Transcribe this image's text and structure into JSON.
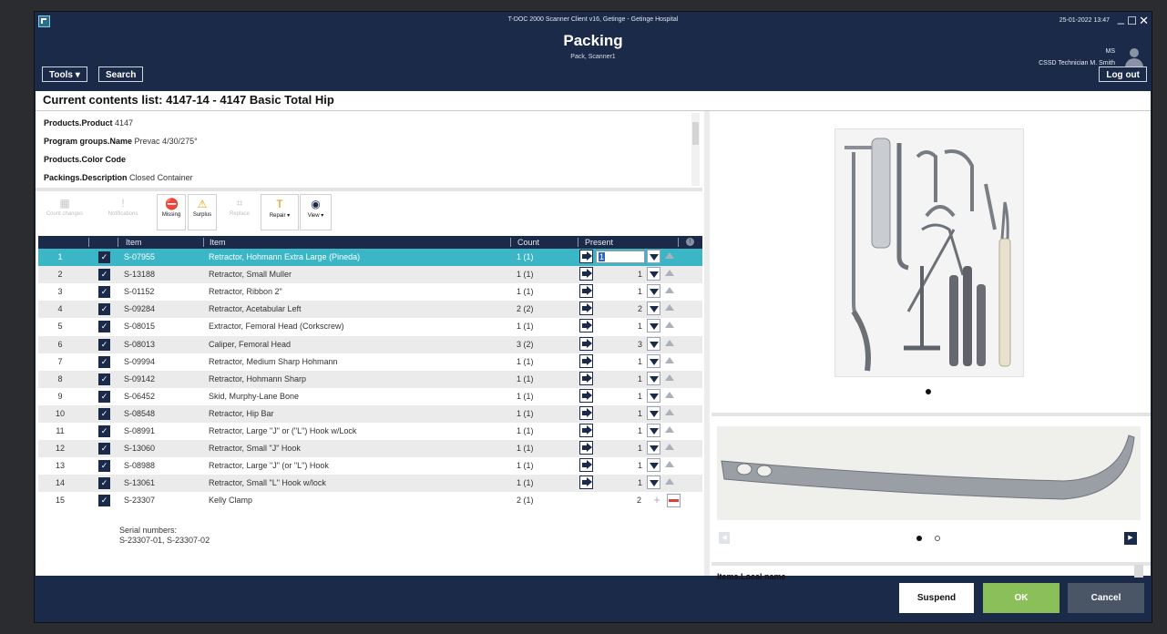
{
  "window": {
    "title": "T-DOC 2000 Scanner Client v16, Getinge - Getinge Hospital",
    "datetime": "25-01-2022 13:47",
    "min_glyph": "_",
    "max_glyph": "☐",
    "close_glyph": "✕"
  },
  "header": {
    "title": "Packing",
    "subtitle": "Pack, Scanner1",
    "tools_label": "Tools ▾",
    "search_label": "Search",
    "logout_label": "Log out",
    "user_initials": "MS",
    "user_role": "CSSD Technician M. Smith"
  },
  "list_title": "Current contents list: 4147-14 - 4147 Basic Total Hip",
  "properties": [
    {
      "label": "Products.Product",
      "value": "4147"
    },
    {
      "label": "Program groups.Name",
      "value": "Prevac 4/30/275°"
    },
    {
      "label": "Products.Color Code",
      "value": ""
    },
    {
      "label": "Packings.Description",
      "value": "Closed Container"
    }
  ],
  "toolbar": [
    {
      "label": "Count changes",
      "enabled": false,
      "icon": "count-changes-icon",
      "glyph": "▦"
    },
    {
      "label": "Notifications",
      "enabled": false,
      "icon": "notification-icon",
      "glyph": "!"
    },
    {
      "label": "Missing",
      "enabled": true,
      "icon": "missing-icon",
      "glyph": "⛔"
    },
    {
      "label": "Surplus",
      "enabled": true,
      "icon": "surplus-icon",
      "glyph": "⚠"
    },
    {
      "label": "Replace",
      "enabled": false,
      "icon": "replace-icon",
      "glyph": "⌗"
    },
    {
      "label": "Repair ▾",
      "enabled": true,
      "icon": "repair-icon",
      "glyph": "T"
    },
    {
      "label": "View ▾",
      "enabled": true,
      "icon": "view-icon",
      "glyph": "◉"
    }
  ],
  "table": {
    "headers": {
      "item": "Item",
      "item2": "Item",
      "count": "Count",
      "present": "Present",
      "info": "!"
    },
    "rows": [
      {
        "n": "1",
        "code": "S-07955",
        "name": "Retractor, Hohmann Extra Large (Pineda)",
        "count": "1 (1)",
        "present": "1"
      },
      {
        "n": "2",
        "code": "S-13188",
        "name": "Retractor, Small Muller",
        "count": "1 (1)",
        "present": "1"
      },
      {
        "n": "3",
        "code": "S-01152",
        "name": "Retractor, Ribbon 2\"",
        "count": "1 (1)",
        "present": "1"
      },
      {
        "n": "4",
        "code": "S-09284",
        "name": "Retractor, Acetabular Left",
        "count": "2 (2)",
        "present": "2"
      },
      {
        "n": "5",
        "code": "S-08015",
        "name": "Extractor, Femoral Head (Corkscrew)",
        "count": "1 (1)",
        "present": "1"
      },
      {
        "n": "6",
        "code": "S-08013",
        "name": "Caliper, Femoral Head",
        "count": "3 (2)",
        "present": "3"
      },
      {
        "n": "7",
        "code": "S-09994",
        "name": "Retractor, Medium Sharp Hohmann",
        "count": "1 (1)",
        "present": "1"
      },
      {
        "n": "8",
        "code": "S-09142",
        "name": "Retractor, Hohmann Sharp",
        "count": "1 (1)",
        "present": "1"
      },
      {
        "n": "9",
        "code": "S-06452",
        "name": "Skid, Murphy-Lane Bone",
        "count": "1 (1)",
        "present": "1"
      },
      {
        "n": "10",
        "code": "S-08548",
        "name": "Retractor, Hip Bar",
        "count": "1 (1)",
        "present": "1"
      },
      {
        "n": "11",
        "code": "S-08991",
        "name": "Retractor, Large \"J\" or (\"L\") Hook w/Lock",
        "count": "1 (1)",
        "present": "1"
      },
      {
        "n": "12",
        "code": "S-13060",
        "name": "Retractor, Small \"J\" Hook",
        "count": "1 (1)",
        "present": "1"
      },
      {
        "n": "13",
        "code": "S-08988",
        "name": "Retractor, Large \"J\" (or \"L\") Hook",
        "count": "1 (1)",
        "present": "1"
      },
      {
        "n": "14",
        "code": "S-13061",
        "name": "Retractor, Small \"L\" Hook w/lock",
        "count": "1 (1)",
        "present": "1"
      },
      {
        "n": "15",
        "code": "S-23307",
        "name": "Kelly Clamp",
        "count": "2 (1)",
        "present": "2"
      }
    ],
    "serial_label": "Serial numbers:",
    "serial_values": "S-23307-01, S-23307-02",
    "check_glyph": "✓"
  },
  "right_panel": {
    "local_name_label": "Items.Local name",
    "nav_prev": "◀",
    "nav_next": "▶"
  },
  "footer": {
    "suspend": "Suspend",
    "ok": "OK",
    "cancel": "Cancel"
  },
  "colors": {
    "navy": "#1c2a49",
    "selected_row": "#3ab6c7",
    "ok_green": "#8bbf5a",
    "cancel_gray": "#4a5566"
  }
}
